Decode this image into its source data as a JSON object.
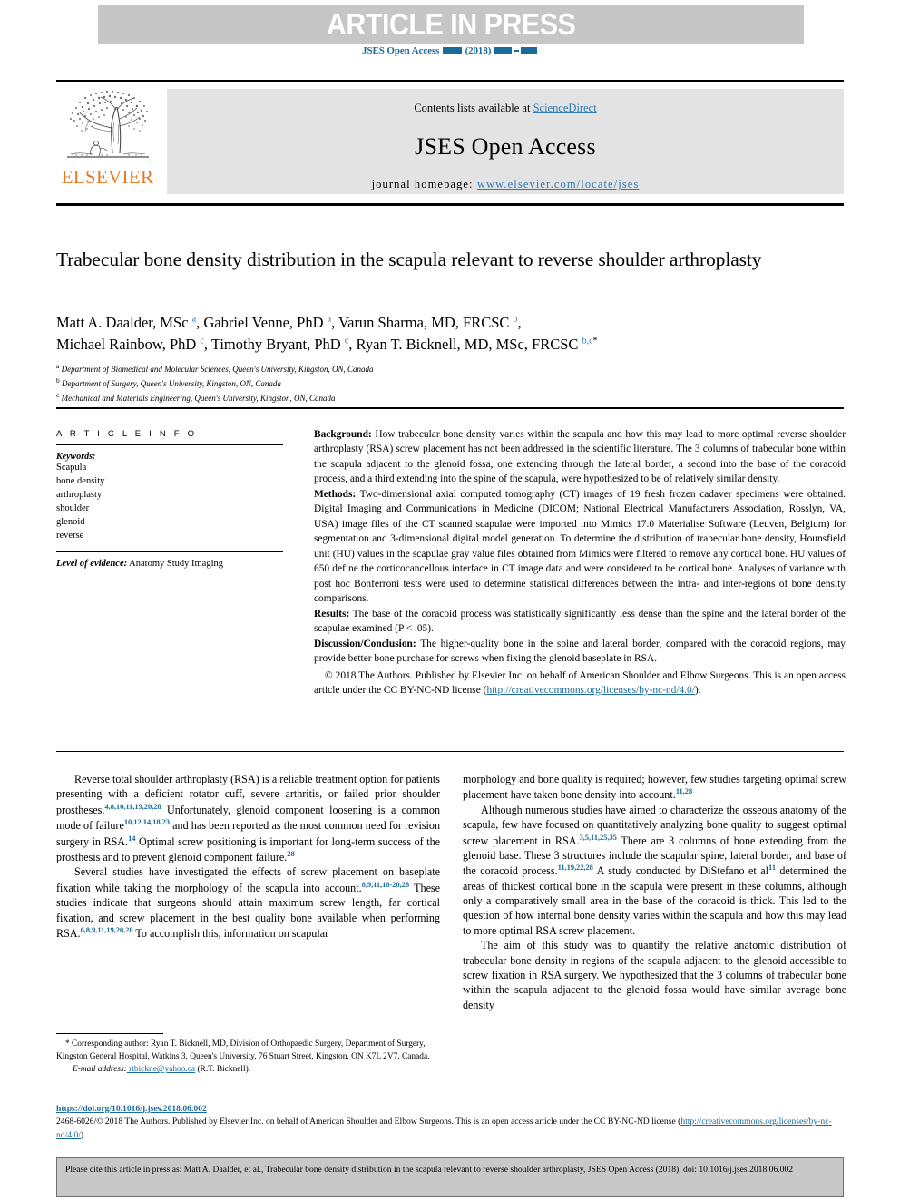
{
  "banner": {
    "text": "ARTICLE IN PRESS"
  },
  "journal_ref": {
    "name": "JSES Open Access",
    "year": "(2018)"
  },
  "masthead": {
    "contents_prefix": "Contents lists available at ",
    "sciencedirect": "ScienceDirect",
    "journal_name": "JSES Open Access",
    "homepage_label": "journal homepage: ",
    "homepage_url": "www.elsevier.com/locate/jses",
    "publisher_logo_word": "ELSEVIER"
  },
  "article": {
    "title": "Trabecular bone density distribution in the scapula relevant to reverse shoulder arthroplasty",
    "authors_line_1_a": "Matt A. Daalder, MSc ",
    "authors_line_1_b": ", Gabriel Venne, PhD ",
    "authors_line_1_c": ", Varun Sharma, MD, FRCSC ",
    "authors_line_2_a": "Michael Rainbow, PhD ",
    "authors_line_2_b": ", Timothy Bryant, PhD ",
    "authors_line_2_c": ", Ryan T. Bicknell, MD, MSc, FRCSC ",
    "sup_a": "a",
    "sup_b": "b",
    "sup_c": "c",
    "sup_bc": "b,c",
    "sup_star": "*",
    "affiliations": [
      {
        "mark": "a",
        "text": "Department of Biomedical and Molecular Sciences, Queen's University, Kingston, ON, Canada"
      },
      {
        "mark": "b",
        "text": "Department of Surgery, Queen's University, Kingston, ON, Canada"
      },
      {
        "mark": "c",
        "text": "Mechanical and Materials Engineering, Queen's University, Kingston, ON, Canada"
      }
    ]
  },
  "article_info": {
    "heading": "A R T I C L E   I N F O",
    "keywords_label": "Keywords:",
    "keywords": [
      "Scapula",
      "bone density",
      "arthroplasty",
      "shoulder",
      "glenoid",
      "reverse"
    ],
    "level_of_evidence_label": "Level of evidence:",
    "level_of_evidence_value": " Anatomy Study Imaging"
  },
  "abstract": {
    "background_label": "Background:",
    "background_text": " How trabecular bone density varies within the scapula and how this may lead to more optimal reverse shoulder arthroplasty (RSA) screw placement has not been addressed in the scientific literature. The 3 columns of trabecular bone within the scapula adjacent to the glenoid fossa, one extending through the lateral border, a second into the base of the coracoid process, and a third extending into the spine of the scapula, were hypothesized to be of relatively similar density.",
    "methods_label": "Methods:",
    "methods_text": " Two-dimensional axial computed tomography (CT) images of 19 fresh frozen cadaver specimens were obtained. Digital Imaging and Communications in Medicine (DICOM; National Electrical Manufacturers Association, Rosslyn, VA, USA) image files of the CT scanned scapulae were imported into Mimics 17.0 Materialise Software (Leuven, Belgium) for segmentation and 3-dimensional digital model generation. To determine the distribution of trabecular bone density, Hounsfield unit (HU) values in the scapulae gray value files obtained from Mimics were filtered to remove any cortical bone. HU values of 650 define the corticocancellous interface in CT image data and were considered to be cortical bone. Analyses of variance with post hoc Bonferroni tests were used to determine statistical differences between the intra- and inter-regions of bone density comparisons.",
    "results_label": "Results:",
    "results_text": " The base of the coracoid process was statistically significantly less dense than the spine and the lateral border of the scapulae examined (P < .05).",
    "discussion_label": "Discussion/Conclusion:",
    "discussion_text": " The higher-quality bone in the spine and lateral border, compared with the coracoid regions, may provide better bone purchase for screws when fixing the glenoid baseplate in RSA.",
    "copyright_text": "© 2018 The Authors. Published by Elsevier Inc. on behalf of American Shoulder and Elbow Surgeons. This is an open access article under the CC BY-NC-ND license (",
    "license_url": "http://creativecommons.org/licenses/by-nc-nd/4.0/",
    "copyright_tail": ")."
  },
  "body": {
    "left": {
      "p1_part1": "Reverse total shoulder arthroplasty (RSA) is a reliable treatment option for patients presenting with a deficient rotator cuff, severe arthritis, or failed prior shoulder prostheses.",
      "p1_cite1": "4,8,10,11,19,20,28",
      "p1_part2": " Unfortunately, glenoid component loosening is a common mode of failure",
      "p1_cite2": "10,12,14,18,23",
      "p1_part3": " and has been reported as the most common need for revision surgery in RSA.",
      "p1_cite3": "14",
      "p1_part4": " Optimal screw positioning is important for long-term success of the prosthesis and to prevent glenoid component failure.",
      "p1_cite4": "28",
      "p2_part1": "Several studies have investigated the effects of screw placement on baseplate fixation while taking the morphology of the scapula into account.",
      "p2_cite1": "8,9,11,18-20,28",
      "p2_part2": " These studies indicate that surgeons should attain maximum screw length, far cortical fixation, and screw placement in the best quality bone available when performing RSA.",
      "p2_cite2": "6,8,9,11,19,20,28",
      "p2_part3": " To accomplish this, information on scapular"
    },
    "right": {
      "p1_part1": "morphology and bone quality is required; however, few studies targeting optimal screw placement have taken bone density into account.",
      "p1_cite1": "11,28",
      "p2_part1": "Although numerous studies have aimed to characterize the osseous anatomy of the scapula, few have focused on quantitatively analyzing bone quality to suggest optimal screw placement in RSA.",
      "p2_cite1": "3,5,11,25,35",
      "p2_part2": " There are 3 columns of bone extending from the glenoid base. These 3 structures include the scapular spine, lateral border, and base of the coracoid process.",
      "p2_cite2": "11,19,22,28",
      "p2_part3": " A study conducted by DiStefano et al",
      "p2_cite3": "11",
      "p2_part4": " determined the areas of thickest cortical bone in the scapula were present in these columns, although only a comparatively small area in the base of the coracoid is thick. This led to the question of how internal bone density varies within the scapula and how this may lead to more optimal RSA screw placement.",
      "p3_text": "The aim of this study was to quantify the relative anatomic distribution of trabecular bone density in regions of the scapula adjacent to the glenoid accessible to screw fixation in RSA surgery. We hypothesized that the 3 columns of trabecular bone within the scapula adjacent to the glenoid fossa would have similar average bone density"
    }
  },
  "footnote": {
    "star": "*",
    "corresponding_text": " Corresponding author: Ryan T. Bicknell, MD, Division of Orthopaedic Surgery, Department of Surgery, Kingston General Hospital, Watkins 3, Queen's University, 76 Stuart Street, Kingston, ON K7L 2V7, Canada.",
    "email_label": "E-mail address:",
    "email": " rtbickne@yahoo.ca",
    "email_attrib": " (R.T. Bicknell)."
  },
  "doi_block": {
    "doi_url": "https://doi.org/10.1016/j.jses.2018.06.002",
    "issn_line_part1": "2468-6026/© 2018 The Authors. Published by Elsevier Inc. on behalf of American Shoulder and Elbow Surgeons. This is an open access article under the CC BY-NC-ND license (",
    "license_url": "http://creativecommons.org/licenses/by-nc-nd/4.0/",
    "issn_line_tail": ")."
  },
  "citation_box": {
    "text": "Please cite this article in press as: Matt A. Daalder, et al., Trabecular bone density distribution in the scapula relevant to reverse shoulder arthroplasty, JSES Open Access (2018), doi: 10.1016/j.jses.2018.06.002"
  },
  "colors": {
    "banner_bg": "#c6c6c6",
    "link_blue": "#2e7bb5",
    "cite_blue": "#1a6b9c",
    "elsevier_orange": "#e87722",
    "masthead_bg": "#e3e3e3",
    "citebox_bg": "#c8c8c8"
  }
}
